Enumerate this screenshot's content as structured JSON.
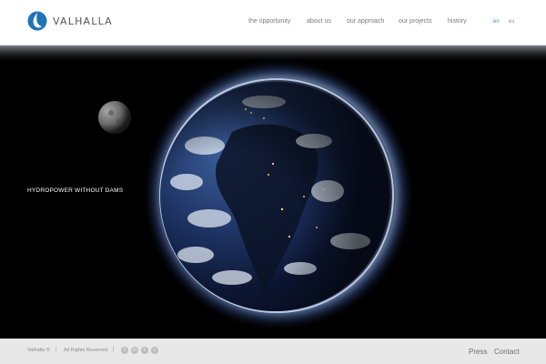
{
  "header": {
    "brand": "VALHALLA",
    "nav": [
      {
        "label": "the opportunity"
      },
      {
        "label": "about us"
      },
      {
        "label": "our approach"
      },
      {
        "label": "our projects"
      },
      {
        "label": "history"
      }
    ],
    "languages": [
      {
        "label": "en",
        "active": true
      },
      {
        "label": "es",
        "active": false
      }
    ],
    "colors": {
      "accent": "#2a8fd6",
      "logo": "#1f73b7"
    }
  },
  "hero": {
    "tagline": "HYDROPOWER WITHOUT DAMS",
    "background": "#000000"
  },
  "footer": {
    "copyright": "Valhalla ®",
    "separator": "|",
    "rights": "All Rights Reserved",
    "social_icons": [
      "facebook-icon",
      "linkedin-icon",
      "twitter-icon",
      "vimeo-icon"
    ],
    "press": "Press",
    "contact": "Contact"
  }
}
